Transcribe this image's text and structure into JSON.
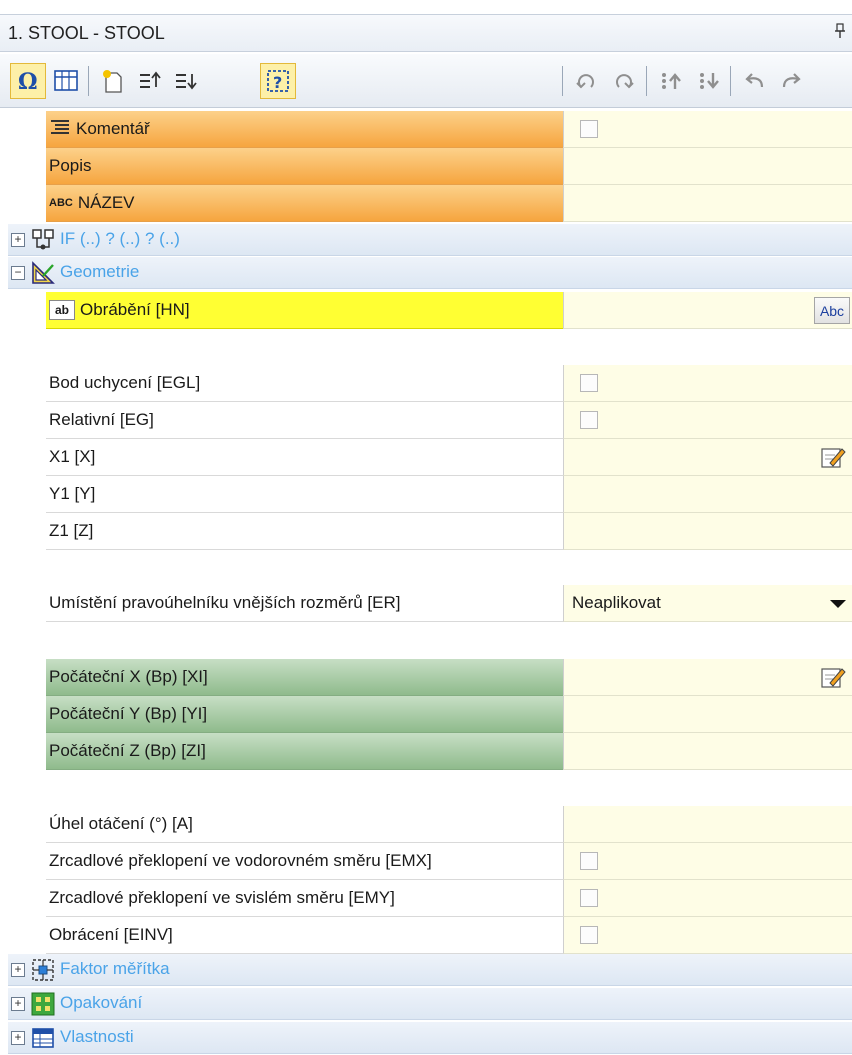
{
  "panel": {
    "title": "1. STOOL - STOOL",
    "pin_icon": "pin-icon"
  },
  "toolbar": {
    "left": [
      "omega-icon",
      "grid-icon",
      "new-item-icon",
      "move-up-icon",
      "move-down-icon",
      "selection-icon"
    ],
    "right": [
      "rotate-left-icon",
      "rotate-right-icon",
      "arrange-up-icon",
      "arrange-down-icon",
      "undo-icon",
      "redo-icon"
    ]
  },
  "rows": {
    "komentar": "Komentář",
    "popis": "Popis",
    "nazev": "NÁZEV",
    "nazev_prefix": "ABC",
    "if_group": "IF (..) ? (..) ? (..)",
    "geometrie": "Geometrie",
    "obrabeni": "Obrábění [HN]",
    "obrabeni_prefix": "ab",
    "abc_button": "Abc",
    "bod": "Bod uchycení [EGL]",
    "relativni": "Relativní [EG]",
    "x1": "X1 [X]",
    "y1": "Y1 [Y]",
    "z1": "Z1 [Z]",
    "umisteni": "Umístění pravoúhelníku vnějších rozměrů [ER]",
    "umisteni_value": "Neaplikovat",
    "pocx": "Počáteční X (Bp) [XI]",
    "pocy": "Počáteční Y (Bp) [YI]",
    "pocz": "Počáteční Z (Bp) [ZI]",
    "uhel": "Úhel otáčení (°) [A]",
    "emx": "Zrcadlové překlopení ve vodorovném směru [EMX]",
    "emy": "Zrcadlové překlopení ve svislém směru [EMY]",
    "einv": "Obrácení [EINV]",
    "faktor": "Faktor měřítka",
    "opakovani": "Opakování",
    "vlastnosti": "Vlastnosti"
  },
  "expanders": {
    "collapsed": "+",
    "expanded": "−"
  }
}
